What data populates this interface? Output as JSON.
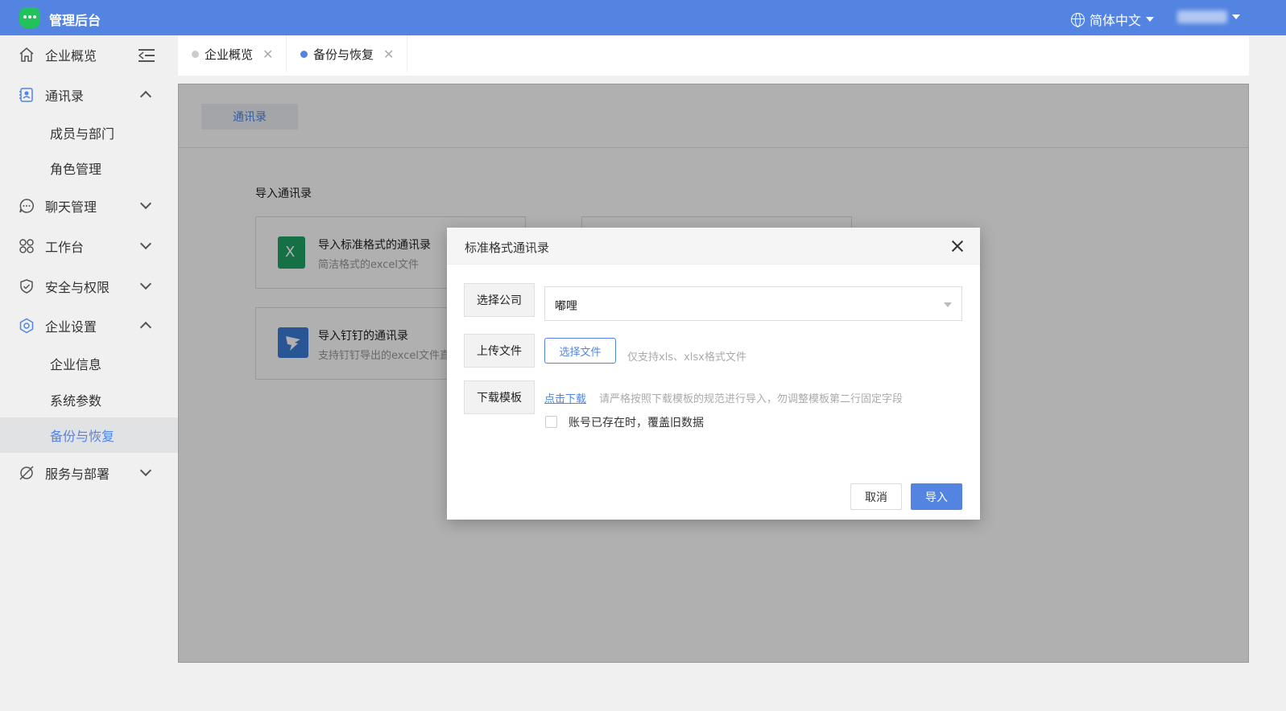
{
  "app": {
    "title": "管理后台"
  },
  "topbar": {
    "language": "简体中文"
  },
  "sidebar": {
    "items": [
      {
        "label": "企业概览",
        "icon": "home-icon"
      },
      {
        "label": "通讯录",
        "icon": "contacts-icon",
        "expanded": true,
        "children": [
          "成员与部门",
          "角色管理"
        ]
      },
      {
        "label": "聊天管理",
        "icon": "chat-icon",
        "expanded": false
      },
      {
        "label": "工作台",
        "icon": "workbench-icon",
        "expanded": false
      },
      {
        "label": "安全与权限",
        "icon": "shield-icon",
        "expanded": false
      },
      {
        "label": "企业设置",
        "icon": "settings-icon",
        "expanded": true,
        "children": [
          "企业信息",
          "系统参数",
          "备份与恢复"
        ]
      },
      {
        "label": "服务与部署",
        "icon": "planet-icon",
        "expanded": false
      }
    ],
    "active_item": "备份与恢复"
  },
  "tabs": [
    {
      "label": "企业概览",
      "active": false
    },
    {
      "label": "备份与恢复",
      "active": true
    }
  ],
  "content": {
    "sub_tab": "通讯录",
    "section_title": "导入通讯录",
    "cards": [
      {
        "title": "导入标准格式的通讯录",
        "desc": "简洁格式的excel文件",
        "icon": "excel-icon"
      },
      {
        "title": "导入钉钉的通讯录",
        "desc": "支持钉钉导出的excel文件直",
        "icon": "dingtalk-icon"
      }
    ]
  },
  "modal": {
    "title": "标准格式通讯录",
    "company_label": "选择公司",
    "company_value": "嘟哩",
    "upload_label": "上传文件",
    "choose_file": "选择文件",
    "upload_hint": "仅支持xls、xlsx格式文件",
    "template_label": "下载模板",
    "download_link": "点击下载",
    "template_hint": "请严格按照下载模板的规范进行导入，勿调整模板第二行固定字段",
    "overwrite_label": "账号已存在时，覆盖旧数据",
    "overwrite_checked": false,
    "cancel": "取消",
    "confirm": "导入"
  },
  "colors": {
    "primary": "#5384e2",
    "logo": "#21c25a",
    "excel": "#21a366",
    "dingtalk": "#3a7bd5"
  }
}
